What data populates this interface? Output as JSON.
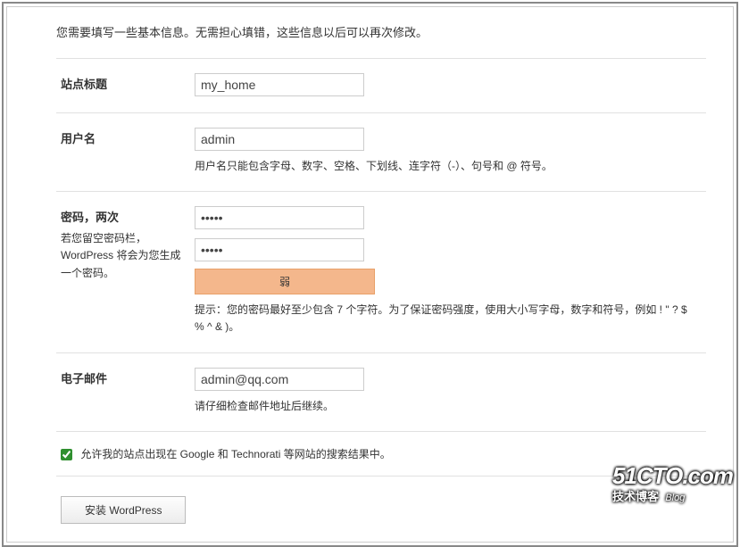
{
  "intro": "您需要填写一些基本信息。无需担心填错，这些信息以后可以再次修改。",
  "fields": {
    "site_title": {
      "label": "站点标题",
      "value": "my_home"
    },
    "username": {
      "label": "用户名",
      "value": "admin",
      "description": "用户名只能包含字母、数字、空格、下划线、连字符（-）、句号和 @ 符号。"
    },
    "password": {
      "label": "密码，两次",
      "sub": "若您留空密码栏，WordPress 将会为您生成一个密码。",
      "value1": "•••••",
      "value2": "•••••",
      "strength": "弱",
      "hint": "提示：您的密码最好至少包含 7 个字符。为了保证密码强度，使用大小写字母，数字和符号，例如 ! \" ? $ % ^ & )。"
    },
    "email": {
      "label": "电子邮件",
      "value": "admin@qq.com",
      "description": "请仔细检查邮件地址后继续。"
    }
  },
  "checkbox": {
    "label": "允许我的站点出现在 Google 和 Technorati 等网站的搜索结果中。"
  },
  "submit": {
    "label": "安装 WordPress"
  },
  "branding": {
    "logo": "51CTO.com",
    "tagline": "技术博客",
    "blog": "Blog"
  }
}
